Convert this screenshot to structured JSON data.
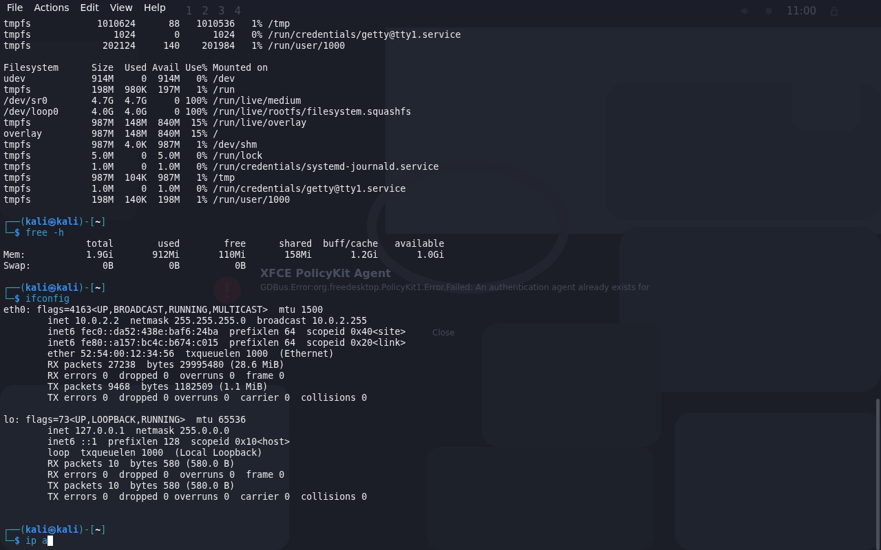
{
  "desktop": {
    "workspaces": [
      "1",
      "2",
      "3",
      "4"
    ],
    "clock": "11:00",
    "notification": {
      "title": "XFCE PolicyKit Agent",
      "message": "GDBus.Error:org.freedesktop.PolicyKit1.Error.Failed: An authentication agent already exists for",
      "close": "Close"
    }
  },
  "menu": [
    "File",
    "Actions",
    "Edit",
    "View",
    "Help"
  ],
  "terminal": {
    "lines": [
      {
        "kind": "output",
        "text": "tmpfs            1010624      88   1010536   1% /tmp"
      },
      {
        "kind": "output",
        "text": "tmpfs               1024       0      1024   0% /run/credentials/getty@tty1.service"
      },
      {
        "kind": "output",
        "text": "tmpfs             202124     140    201984   1% /run/user/1000"
      },
      {
        "kind": "blank"
      },
      {
        "kind": "output",
        "text": "Filesystem      Size  Used Avail Use% Mounted on"
      },
      {
        "kind": "output",
        "text": "udev            914M     0  914M   0% /dev"
      },
      {
        "kind": "output",
        "text": "tmpfs           198M  980K  197M   1% /run"
      },
      {
        "kind": "output",
        "text": "/dev/sr0        4.7G  4.7G     0 100% /run/live/medium"
      },
      {
        "kind": "output",
        "text": "/dev/loop0      4.0G  4.0G     0 100% /run/live/rootfs/filesystem.squashfs"
      },
      {
        "kind": "output",
        "text": "tmpfs           987M  148M  840M  15% /run/live/overlay"
      },
      {
        "kind": "output",
        "text": "overlay         987M  148M  840M  15% /"
      },
      {
        "kind": "output",
        "text": "tmpfs           987M  4.0K  987M   1% /dev/shm"
      },
      {
        "kind": "output",
        "text": "tmpfs           5.0M     0  5.0M   0% /run/lock"
      },
      {
        "kind": "output",
        "text": "tmpfs           1.0M     0  1.0M   0% /run/credentials/systemd-journald.service"
      },
      {
        "kind": "output",
        "text": "tmpfs           987M  104K  987M   1% /tmp"
      },
      {
        "kind": "output",
        "text": "tmpfs           1.0M     0  1.0M   0% /run/credentials/getty@tty1.service"
      },
      {
        "kind": "output",
        "text": "tmpfs           198M  140K  198M   1% /run/user/1000"
      },
      {
        "kind": "blank"
      },
      {
        "kind": "prompt",
        "open": "┌──(",
        "user": "kali",
        "at": "㉿",
        "host": "kali",
        "mid": ")-[",
        "dir": "~",
        "close": "]"
      },
      {
        "kind": "command",
        "lead": "└─",
        "sigil": "$",
        "text": "free -h",
        "cursor": false
      },
      {
        "kind": "output",
        "text": "               total        used        free      shared  buff/cache   available"
      },
      {
        "kind": "output",
        "text": "Mem:           1.9Gi       912Mi       110Mi       158Mi       1.2Gi       1.0Gi"
      },
      {
        "kind": "output",
        "text": "Swap:             0B          0B          0B"
      },
      {
        "kind": "blank"
      },
      {
        "kind": "prompt",
        "open": "┌──(",
        "user": "kali",
        "at": "㉿",
        "host": "kali",
        "mid": ")-[",
        "dir": "~",
        "close": "]"
      },
      {
        "kind": "command",
        "lead": "└─",
        "sigil": "$",
        "text": "ifconfig",
        "cursor": false
      },
      {
        "kind": "output",
        "text": "eth0: flags=4163<UP,BROADCAST,RUNNING,MULTICAST>  mtu 1500"
      },
      {
        "kind": "output",
        "text": "        inet 10.0.2.2  netmask 255.255.255.0  broadcast 10.0.2.255"
      },
      {
        "kind": "output",
        "text": "        inet6 fec0::da52:438e:baf6:24ba  prefixlen 64  scopeid 0x40<site>"
      },
      {
        "kind": "output",
        "text": "        inet6 fe80::a157:bc4c:b674:c015  prefixlen 64  scopeid 0x20<link>"
      },
      {
        "kind": "output",
        "text": "        ether 52:54:00:12:34:56  txqueuelen 1000  (Ethernet)"
      },
      {
        "kind": "output",
        "text": "        RX packets 27238  bytes 29995480 (28.6 MiB)"
      },
      {
        "kind": "output",
        "text": "        RX errors 0  dropped 0  overruns 0  frame 0"
      },
      {
        "kind": "output",
        "text": "        TX packets 9468  bytes 1182509 (1.1 MiB)"
      },
      {
        "kind": "output",
        "text": "        TX errors 0  dropped 0 overruns 0  carrier 0  collisions 0"
      },
      {
        "kind": "blank"
      },
      {
        "kind": "output",
        "text": "lo: flags=73<UP,LOOPBACK,RUNNING>  mtu 65536"
      },
      {
        "kind": "output",
        "text": "        inet 127.0.0.1  netmask 255.0.0.0"
      },
      {
        "kind": "output",
        "text": "        inet6 ::1  prefixlen 128  scopeid 0x10<host>"
      },
      {
        "kind": "output",
        "text": "        loop  txqueuelen 1000  (Local Loopback)"
      },
      {
        "kind": "output",
        "text": "        RX packets 10  bytes 580 (580.0 B)"
      },
      {
        "kind": "output",
        "text": "        RX errors 0  dropped 0  overruns 0  frame 0"
      },
      {
        "kind": "output",
        "text": "        TX packets 10  bytes 580 (580.0 B)"
      },
      {
        "kind": "output",
        "text": "        TX errors 0  dropped 0 overruns 0  carrier 0  collisions 0"
      },
      {
        "kind": "blank"
      },
      {
        "kind": "blank"
      },
      {
        "kind": "prompt",
        "open": "┌──(",
        "user": "kali",
        "at": "㉿",
        "host": "kali",
        "mid": ")-[",
        "dir": "~",
        "close": "]"
      },
      {
        "kind": "command",
        "lead": "└─",
        "sigil": "$",
        "text": "ip a",
        "cursor": true
      }
    ]
  }
}
